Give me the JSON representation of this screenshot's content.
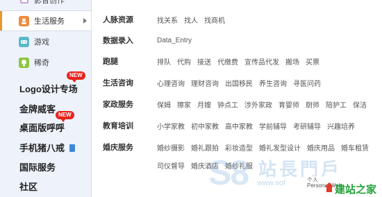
{
  "sidebar": {
    "top_item": {
      "label": "影音创作",
      "icon": "film-icon"
    },
    "active_item": {
      "label": "生活服务",
      "icon": "life-service-icon"
    },
    "game_item": {
      "label": "游戏",
      "icon": "game-icon"
    },
    "weird_item": {
      "label": "稀奇",
      "icon": "idea-icon"
    },
    "bold_items": [
      {
        "label": "Logo设计专场",
        "badge": "NEW"
      },
      {
        "label": "金牌威客"
      },
      {
        "label": "桌面版呼呼",
        "badge": "NEW"
      },
      {
        "label": "手机猪八戒",
        "icon": "mobile-icon"
      },
      {
        "label": "国际服务"
      },
      {
        "label": "社区"
      }
    ]
  },
  "panel": {
    "rows": [
      {
        "label": "人脉资源",
        "links": [
          "找关系",
          "找人",
          "找商机"
        ]
      },
      {
        "label": "数据录入",
        "links": [
          "Data_Entry"
        ]
      },
      {
        "label": "跑腿",
        "links": [
          "排队",
          "代购",
          "接送",
          "代缴费",
          "宣传品代发",
          "搬场",
          "买票"
        ]
      },
      {
        "label": "生活咨询",
        "links": [
          "心理咨询",
          "理财咨询",
          "出国移民",
          "养生咨询",
          "寻医问药"
        ]
      },
      {
        "label": "家政服务",
        "links": [
          "保姆",
          "擦家",
          "月嫂",
          "钟点工",
          "涉外家政",
          "育婴师",
          "厨师",
          "陪护工",
          "保洁"
        ]
      },
      {
        "label": "教育培训",
        "links": [
          "小学家教",
          "初中家教",
          "高中家教",
          "学前辅导",
          "考研辅导",
          "兴趣培养"
        ]
      },
      {
        "label": "婚庆服务",
        "links": [
          "婚纱摄影",
          "婚礼跟拍",
          "彩妆造型",
          "婚礼发型设计",
          "婚庆用品",
          "婚车租赁"
        ]
      },
      {
        "label": "",
        "links": [
          "司仪督导",
          "婚庆酒店",
          "婚纱礼服"
        ]
      }
    ]
  },
  "watermark": {
    "big": "S8",
    "text": "站長門戶",
    "url": "www.sof",
    "small_line1": "个人",
    "small_line2": "Personal Web",
    "brand": "建站之家"
  },
  "colors": {
    "sidebar_bg": "#eef3fb",
    "accent": "#e9962c",
    "badge": "#e8231c",
    "brand_green": "#25a13a"
  }
}
